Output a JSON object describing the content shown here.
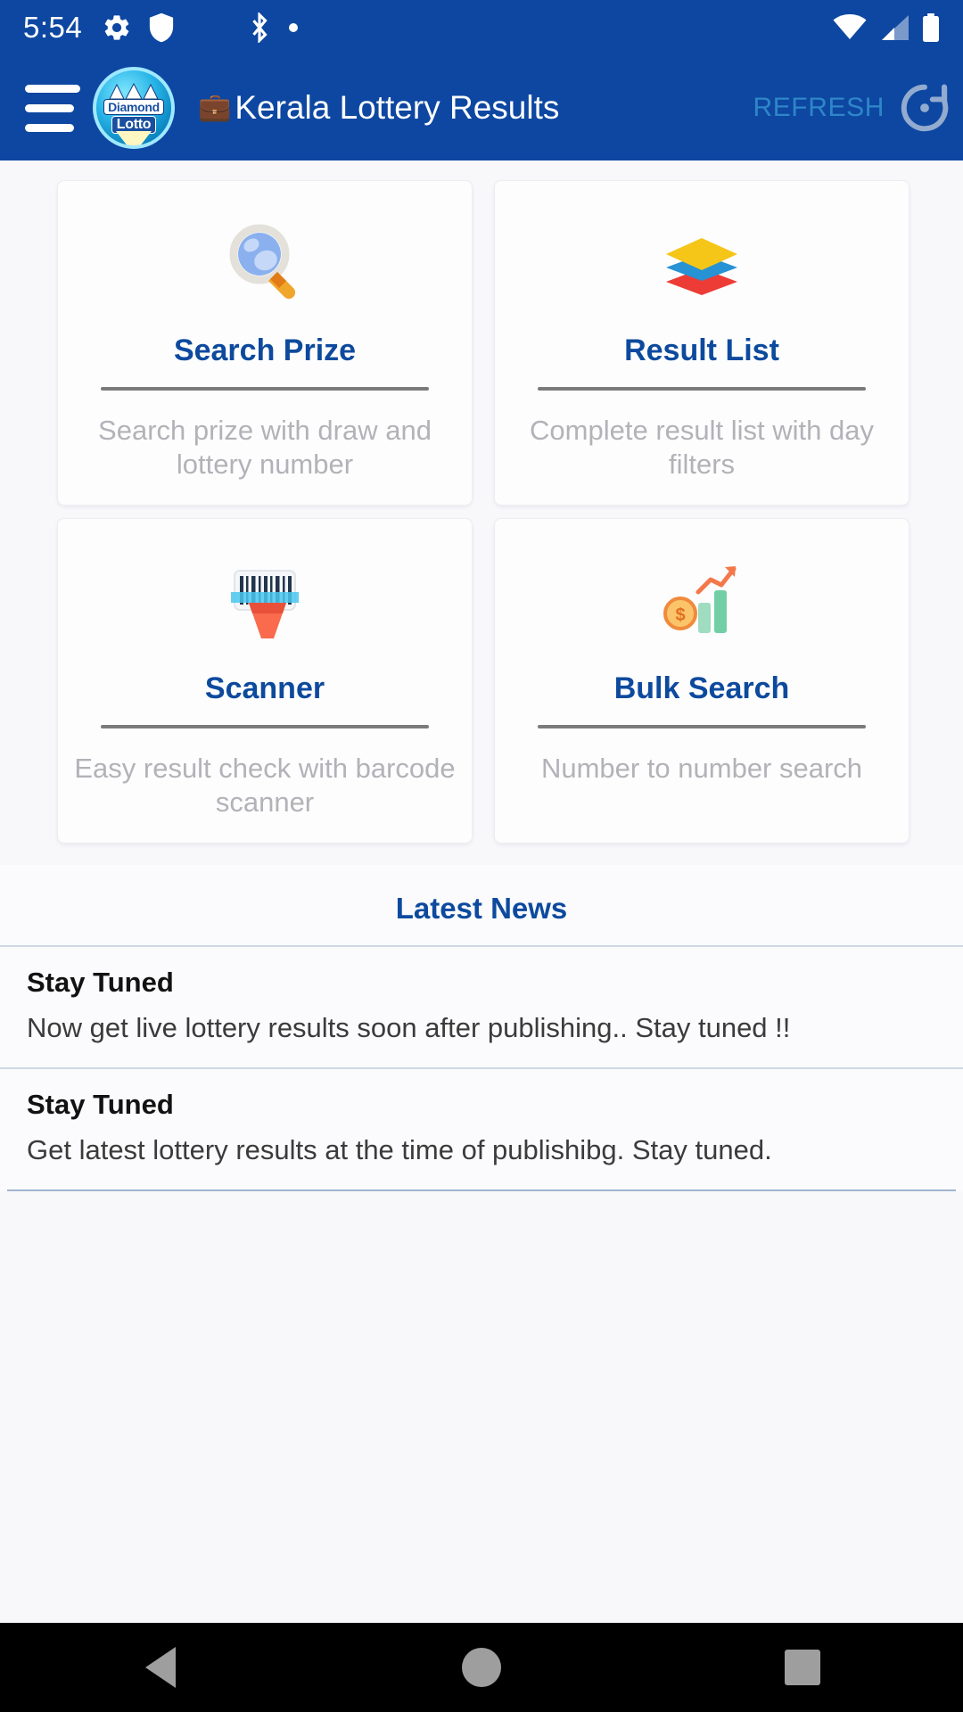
{
  "status_bar": {
    "time": "5:54",
    "left_icons": [
      "gear-icon",
      "shield-play-icon",
      "bluetooth-icon",
      "dot-icon"
    ],
    "right_icons": [
      "wifi-icon",
      "cellular-signal-icon",
      "battery-icon"
    ]
  },
  "app_bar": {
    "menu_icon": "hamburger-menu-icon",
    "logo": {
      "name": "diamond-lotto-logo",
      "line1": "Diamond",
      "line2": "Lotto"
    },
    "title_emoji": "💼",
    "title": "Kerala Lottery Results",
    "refresh_label": "REFRESH",
    "refresh_icon": "refresh-icon"
  },
  "cards": [
    {
      "icon": "magnifying-glass-icon",
      "title": "Search Prize",
      "description": "Search prize with draw and lottery number"
    },
    {
      "icon": "layers-stack-icon",
      "title": "Result List",
      "description": "Complete result list with day filters"
    },
    {
      "icon": "barcode-scanner-icon",
      "title": "Scanner",
      "description": "Easy result check with barcode scanner"
    },
    {
      "icon": "bar-chart-coin-icon",
      "title": "Bulk Search",
      "description": "Number to number search"
    }
  ],
  "news": {
    "heading": "Latest News",
    "items": [
      {
        "title": "Stay Tuned",
        "body": "Now get live lottery results soon after publishing.. Stay tuned !!"
      },
      {
        "title": "Stay Tuned",
        "body": "Get latest lottery results at the time of publishibg. Stay tuned."
      }
    ]
  },
  "nav_bar": {
    "back": "back-triangle-icon",
    "home": "home-circle-icon",
    "recents": "recents-square-icon"
  },
  "colors": {
    "app_bar": "#0d47a1",
    "accent_blue": "#0d4a9e",
    "refresh_text": "#2e86c8",
    "page_bg": "#f8f8fb"
  }
}
